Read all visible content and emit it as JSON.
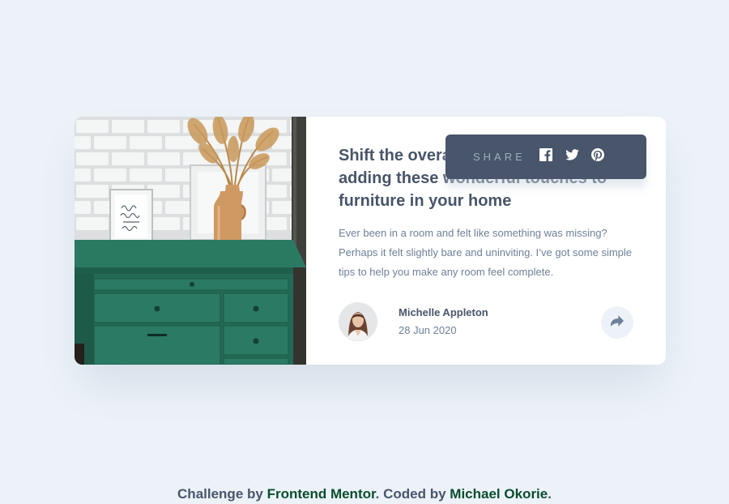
{
  "article": {
    "image_alt": "drawers",
    "title": "Shift the overall look and feel by adding these wonderful touches to furniture in your home",
    "description": "Ever been in a room and felt like something was missing? Perhaps it felt slightly bare and uninviting. I’ve got some simple tips to help you make any room feel complete.",
    "author_name": "Michelle Appleton",
    "date": "28 Jun 2020",
    "share_icon": "share-arrow-icon"
  },
  "share": {
    "label": "SHARE",
    "links": [
      {
        "icon": "facebook-icon"
      },
      {
        "icon": "twitter-icon"
      },
      {
        "icon": "pinterest-icon"
      }
    ]
  },
  "attribution": {
    "prefix": "Challenge by ",
    "link1": "Frontend Mentor",
    "middle": ". Coded by ",
    "link2": "Michael Okorie",
    "suffix": "."
  },
  "colors": {
    "background": "#ecf2f8",
    "title": "#48556a",
    "text": "#6e8098",
    "popup": "#48556a",
    "popup_label": "#9eafc2",
    "link": "#0a4d2e"
  }
}
